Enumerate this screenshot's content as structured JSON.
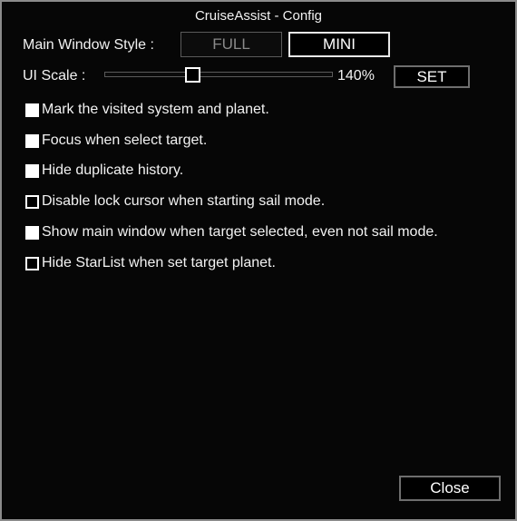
{
  "window": {
    "title": "CruiseAssist - Config"
  },
  "style_row": {
    "label": "Main Window Style :",
    "full_label": "FULL",
    "mini_label": "MINI",
    "selected": "MINI"
  },
  "scale_row": {
    "label": "UI Scale :",
    "value_text": "140%",
    "slider_fraction": 0.38,
    "set_label": "SET"
  },
  "options": [
    {
      "label": "Mark the visited system and planet.",
      "checked": true
    },
    {
      "label": "Focus when select target.",
      "checked": true
    },
    {
      "label": "Hide duplicate history.",
      "checked": true
    },
    {
      "label": "Disable lock cursor when starting sail mode.",
      "checked": false
    },
    {
      "label": "Show main window when target selected, even not sail mode.",
      "checked": true
    },
    {
      "label": "Hide StarList when set target planet.",
      "checked": false
    }
  ],
  "footer": {
    "close_label": "Close"
  },
  "colors": {
    "background": "#060606",
    "border": "#8a8a8a",
    "text": "#f2f2f2",
    "inactive_text": "#8a8a8a"
  }
}
